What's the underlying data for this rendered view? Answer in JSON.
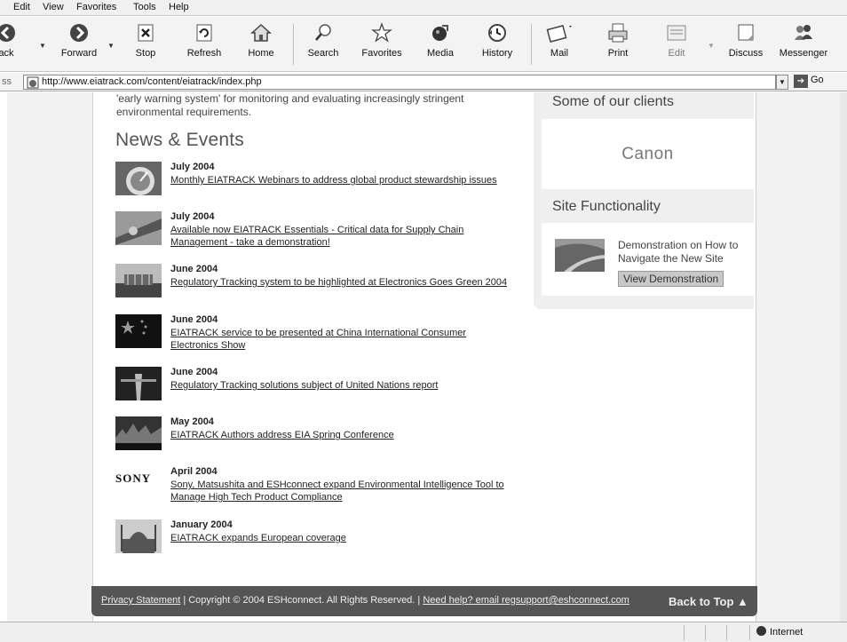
{
  "menu": [
    "Edit",
    "View",
    "Favorites",
    "Tools",
    "Help"
  ],
  "toolbar": {
    "back": "ack",
    "forward": "Forward",
    "stop": "Stop",
    "refresh": "Refresh",
    "home": "Home",
    "search": "Search",
    "favorites": "Favorites",
    "media": "Media",
    "history": "History",
    "mail": "Mail",
    "print": "Print",
    "edit": "Edit",
    "discuss": "Discuss",
    "messenger": "Messenger"
  },
  "address": {
    "label": "ss",
    "url": "http://www.eiatrack.com/content/eiatrack/index.php",
    "go": "Go"
  },
  "intro": "'early warning system' for monitoring and evaluating increasingly stringent environmental requirements.",
  "news": {
    "title": "News & Events",
    "items": [
      {
        "date": "July 2004",
        "link": "Monthly EIATRACK Webinars to address global product stewardship issues"
      },
      {
        "date": "July 2004",
        "link": "Available now EIATRACK Essentials - Critical data for Supply Chain Management - take a demonstration!"
      },
      {
        "date": "June 2004",
        "link": "Regulatory Tracking system to be highlighted at Electronics Goes Green 2004"
      },
      {
        "date": "June 2004",
        "link": "EIATRACK service to be presented at China International Consumer Electronics Show"
      },
      {
        "date": "June 2004",
        "link": "Regulatory Tracking solutions subject of United Nations report"
      },
      {
        "date": "May 2004",
        "link": "EIATRACK Authors address EIA Spring Conference"
      },
      {
        "date": "April 2004",
        "link": "Sony, Matsushita and ESHconnect expand Environmental Intelligence Tool to Manage High Tech Product Compliance",
        "logo": "SONY"
      },
      {
        "date": "January 2004",
        "link": "EIATRACK expands European coverage"
      }
    ]
  },
  "sidebar": {
    "clients_title": "Some of our clients",
    "client_name": "Canon",
    "func_title": "Site Functionality",
    "func_text": "Demonstration on How to Navigate the New Site",
    "demo_button": "View Demonstration"
  },
  "footer": {
    "privacy": "Privacy Statement",
    "copyright": " | Copyright © 2004 ESHconnect. All Rights Reserved. | ",
    "help": "Need help? email regsupport@eshconnect.com",
    "back_top": "Back to Top ▲"
  },
  "status": {
    "zone": "Internet"
  }
}
